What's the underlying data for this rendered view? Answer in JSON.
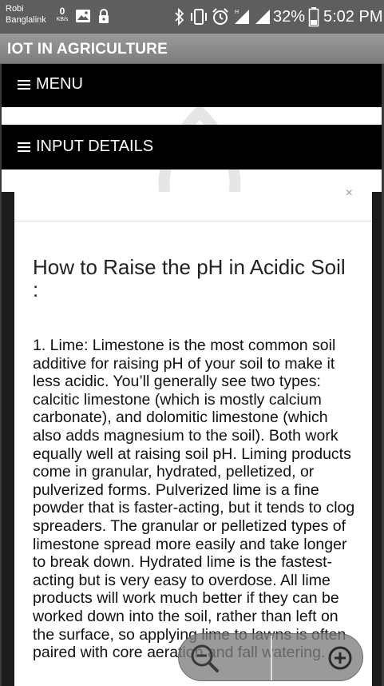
{
  "statusbar": {
    "carrier_line1": "Robi",
    "carrier_line2": "Banglalink",
    "speed_value": "0",
    "speed_unit": "KB/s",
    "battery_percent": "32%",
    "time": "5:02 PM",
    "icons": [
      "image-icon",
      "lock-icon",
      "bluetooth-icon",
      "vibrate-icon",
      "alarm-icon",
      "signal-icon",
      "signal-icon",
      "battery-icon"
    ]
  },
  "app": {
    "title": "IOT IN AGRICULTURE"
  },
  "nav": {
    "menu_label": "MENU",
    "input_details_label": "INPUT DETAILS"
  },
  "dialog": {
    "close_label": "×",
    "heading": "How to Raise the pH in Acidic Soil :",
    "body": "1. Lime: Limestone is the most common soil additive for raising pH of your soil to make it less acidic. You’ll generally see two types: calcitic limestone (which is mostly calcium carbonate), and dolomitic limestone (which also adds magnesium to the soil). Both work equally well at raising soil pH. Liming products come in granular, hydrated, pelletized, or pulverized forms. Pulverized lime is a fine powder that is faster-acting, but it tends to clog spreaders. The granular or pelletized types of limestone spread more easily and take longer to break down. Hydrated lime is the fastest-acting but is very easy to overdose. All lime products will work much better if they can be worked down into the soil, rather than left on the surface, so applying lime to lawns is often paired with core aeration and fall watering."
  },
  "zoom": {
    "zoom_out_icon": "zoom-out-icon",
    "zoom_in_icon": "zoom-in-icon"
  }
}
